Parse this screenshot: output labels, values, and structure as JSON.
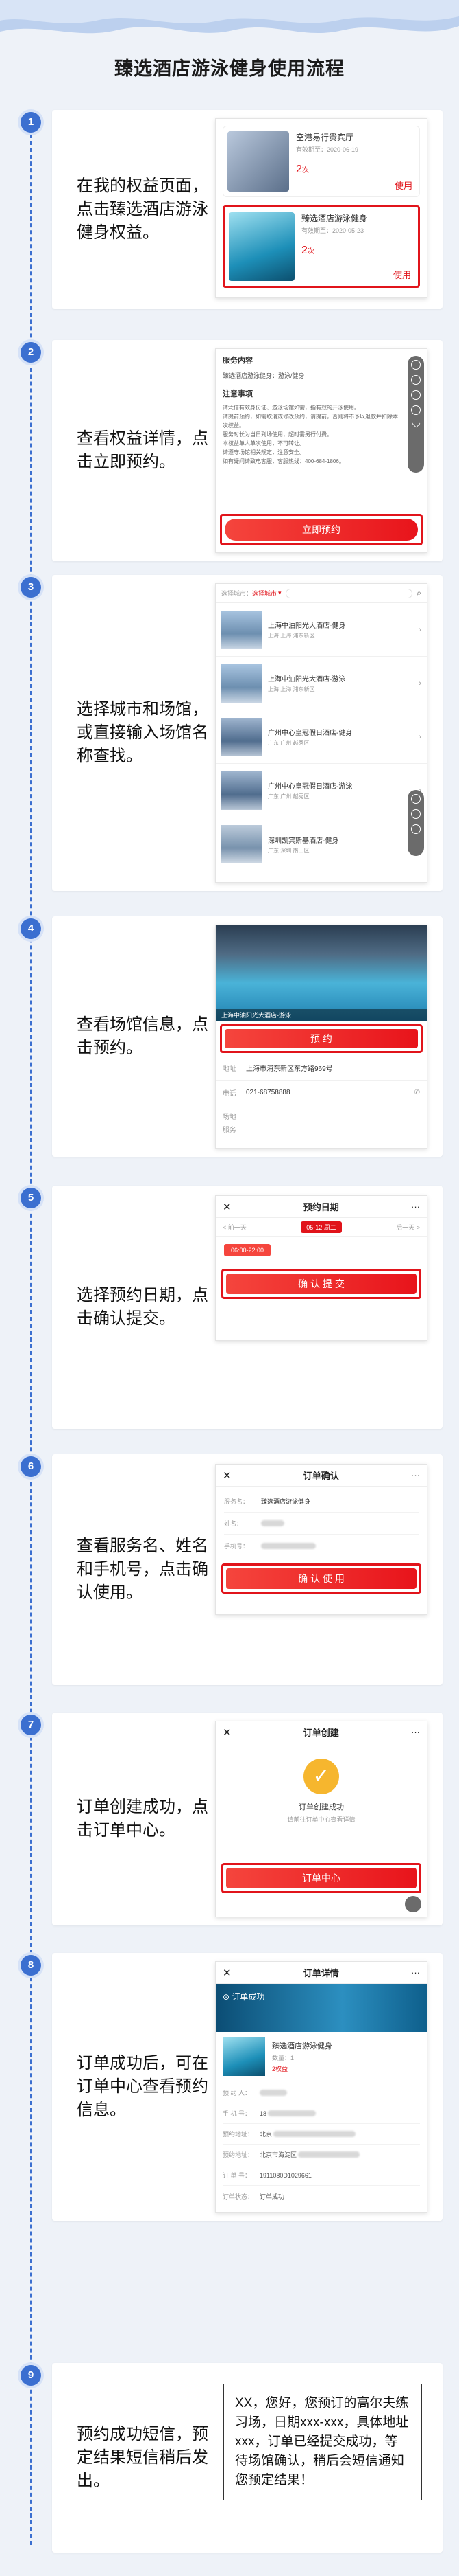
{
  "page_title": "臻选酒店游泳健身使用流程",
  "steps": [
    {
      "num": "1",
      "text": "在我的权益页面，点击臻选酒店游泳健身权益。"
    },
    {
      "num": "2",
      "text": "查看权益详情，点击立即预约。"
    },
    {
      "num": "3",
      "text": "选择城市和场馆，或直接输入场馆名称查找。"
    },
    {
      "num": "4",
      "text": "查看场馆信息，点击预约。"
    },
    {
      "num": "5",
      "text": "选择预约日期，点击确认提交。"
    },
    {
      "num": "6",
      "text": "查看服务名、姓名和手机号，点击确认使用。"
    },
    {
      "num": "7",
      "text": "订单创建成功，点击订单中心。"
    },
    {
      "num": "8",
      "text": "订单成功后，可在订单中心查看预约信息。"
    },
    {
      "num": "9",
      "text": "预约成功短信，预定结果短信稍后发出。"
    }
  ],
  "s1": {
    "card1": {
      "name": "空港易行贵宾厅",
      "valid": "有效期至：2020-06-19",
      "count": "2",
      "unit": "次",
      "action": "使用"
    },
    "card2": {
      "name": "臻选酒店游泳健身",
      "valid": "有效期至：2020-05-23",
      "count": "2",
      "unit": "次",
      "action": "使用"
    }
  },
  "s2": {
    "section1": "服务内容",
    "bullet1": "臻选酒店游泳健身：游泳/健身",
    "section2": "注意事项",
    "notes": [
      "请凭借有效身份证、游泳场馆如需，指有效的开泳使用。",
      "请提前预约，如需取消或修改预约，请提前，否则将不予以退款并扣除本次权益。",
      "服务时长为当日到场使用，超时需另行付费。",
      "本权益单人单次使用，不可转让。",
      "请遵守场馆相关规定，注意安全。",
      "如有疑问请致电客服，客服热线：400-684-1806。"
    ],
    "button": "立即预约",
    "side_label": "联系"
  },
  "s3": {
    "filter_label": "选择城市：",
    "filter_value": "选择城市",
    "venues": [
      {
        "name": "上海中油阳光大酒店-健身",
        "addr": "上海 上海 浦东新区"
      },
      {
        "name": "上海中油阳光大酒店-游泳",
        "addr": "上海 上海 浦东新区"
      },
      {
        "name": "广州中心皇冠假日酒店-健身",
        "addr": "广东 广州 越秀区"
      },
      {
        "name": "广州中心皇冠假日酒店-游泳",
        "addr": "广东 广州 越秀区"
      },
      {
        "name": "深圳凯宾斯基酒店-健身",
        "addr": "广东 深圳 南山区"
      }
    ]
  },
  "s4": {
    "banner_caption": "上海中油阳光大酒店-游泳",
    "button": "预 约",
    "addr_label": "地址",
    "addr": "上海市浦东新区东方路969号",
    "phone_label": "电话",
    "phone": "021-68758888",
    "extra1": "场地",
    "extra2": "服务"
  },
  "s5": {
    "title": "预约日期",
    "prev": "< 前一天",
    "date": "05-12 周二",
    "next": "后一天 >",
    "slot": "06:00-22:00",
    "button": "确 认 提 交"
  },
  "s6": {
    "title": "订单确认",
    "service_label": "服务名：",
    "service": "臻选酒店游泳健身",
    "name_label": "姓名：",
    "phone_label": "手机号：",
    "button": "确 认 使 用"
  },
  "s7": {
    "title": "订单创建",
    "status": "订单创建成功",
    "hint": "请前往订单中心查看详情",
    "button": "订单中心"
  },
  "s8": {
    "title": "订单详情",
    "success": "订单成功",
    "product": "臻选酒店游泳健身",
    "qty": "数量：1",
    "price": "2权益",
    "rows": [
      {
        "label": "预 约 人：",
        "value": ""
      },
      {
        "label": "手 机 号：",
        "value": "18"
      },
      {
        "label": "预约地址：",
        "value": "北京"
      },
      {
        "label": "预约地址：",
        "value": "北京市海淀区"
      },
      {
        "label": "订 单 号：",
        "value": "1911080D1029661"
      },
      {
        "label": "订单状态：",
        "value": "订单成功"
      }
    ]
  },
  "s9": {
    "sms": "XX，您好，您预订的高尔夫练习场，日期xxx-xxx，具体地址xxx，订单已经提交成功，等待场馆确认，稍后会短信通知您预定结果！"
  },
  "colors": {
    "accent_blue": "#3b6fd0",
    "brand_red": "#e1141b",
    "bg": "#eef2f8"
  }
}
